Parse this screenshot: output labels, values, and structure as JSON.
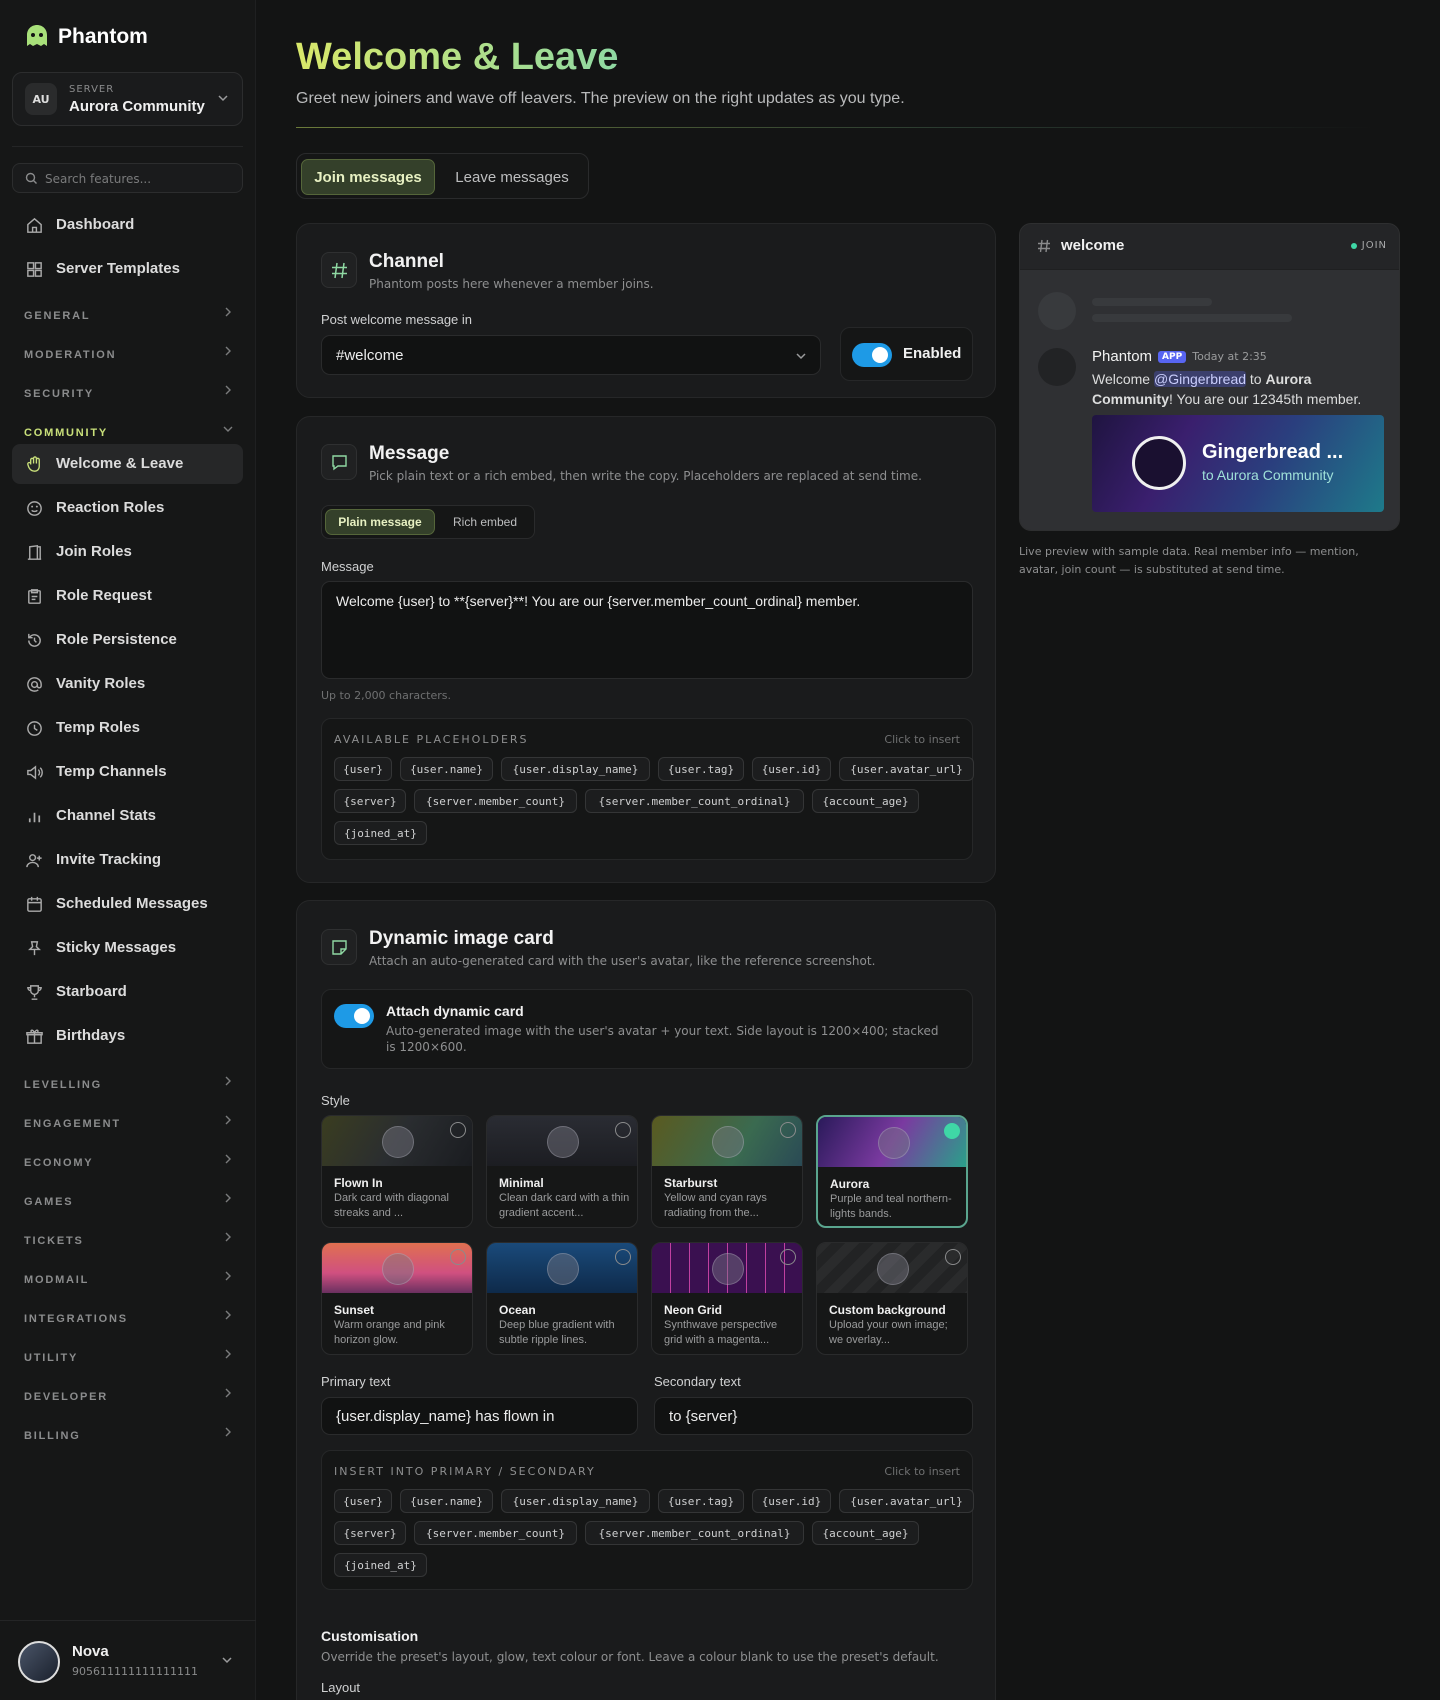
{
  "app": {
    "name": "Phantom"
  },
  "server": {
    "label": "SERVER",
    "initials": "AU",
    "name": "Aurora Community"
  },
  "search": {
    "placeholder": "Search features..."
  },
  "nav_top": [
    {
      "label": "Dashboard",
      "icon": "home-icon"
    },
    {
      "label": "Server Templates",
      "icon": "grid-icon"
    }
  ],
  "sections_collapsed_top": [
    "GENERAL",
    "MODERATION",
    "SECURITY"
  ],
  "section_community": "COMMUNITY",
  "nav_community": [
    {
      "label": "Welcome & Leave",
      "icon": "wave-hand-icon",
      "active": true
    },
    {
      "label": "Reaction Roles",
      "icon": "smile-icon"
    },
    {
      "label": "Join Roles",
      "icon": "door-icon"
    },
    {
      "label": "Role Request",
      "icon": "clipboard-icon"
    },
    {
      "label": "Role Persistence",
      "icon": "history-icon"
    },
    {
      "label": "Vanity Roles",
      "icon": "at-icon"
    },
    {
      "label": "Temp Roles",
      "icon": "clock-icon"
    },
    {
      "label": "Temp Channels",
      "icon": "speaker-icon"
    },
    {
      "label": "Channel Stats",
      "icon": "bar-chart-icon"
    },
    {
      "label": "Invite Tracking",
      "icon": "user-plus-icon"
    },
    {
      "label": "Scheduled Messages",
      "icon": "calendar-icon"
    },
    {
      "label": "Sticky Messages",
      "icon": "pin-icon"
    },
    {
      "label": "Starboard",
      "icon": "trophy-icon"
    },
    {
      "label": "Birthdays",
      "icon": "gift-icon"
    }
  ],
  "sections_collapsed_bottom": [
    "LEVELLING",
    "ENGAGEMENT",
    "ECONOMY",
    "GAMES",
    "TICKETS",
    "MODMAIL",
    "INTEGRATIONS",
    "UTILITY",
    "DEVELOPER",
    "BILLING"
  ],
  "user": {
    "name": "Nova",
    "id": "905611111111111111"
  },
  "page": {
    "title": "Welcome & Leave",
    "subtitle": "Greet new joiners and wave off leavers. The preview on the right updates as you type."
  },
  "tabs": [
    "Join messages",
    "Leave messages"
  ],
  "channel_card": {
    "title": "Channel",
    "desc": "Phantom posts here whenever a member joins.",
    "label": "Post welcome message in",
    "value": "#welcome",
    "toggle_label": "Enabled"
  },
  "message_card": {
    "title": "Message",
    "desc": "Pick plain text or a rich embed, then write the copy. Placeholders are replaced at send time.",
    "modes": [
      "Plain message",
      "Rich embed"
    ],
    "label": "Message",
    "value": "Welcome {user} to **{server}**! You are our {server.member_count_ordinal} member.",
    "hint": "Up to 2,000 characters.",
    "ph_title": "AVAILABLE PLACEHOLDERS",
    "ph_hint": "Click to insert"
  },
  "placeholders": [
    "{user}",
    "{user.name}",
    "{user.display_name}",
    "{user.tag}",
    "{user.id}",
    "{user.avatar_url}",
    "{server}",
    "{server.member_count}",
    "{server.member_count_ordinal}",
    "{account_age}",
    "{joined_at}"
  ],
  "image_card": {
    "title": "Dynamic image card",
    "desc": "Attach an auto-generated card with the user's avatar, like the reference screenshot.",
    "attach_title": "Attach dynamic card",
    "attach_desc": "Auto-generated image with the user's avatar + your text. Side layout is 1200×400; stacked is 1200×600.",
    "style_label": "Style",
    "styles": [
      {
        "name": "Flown In",
        "desc": "Dark card with diagonal streaks and ..."
      },
      {
        "name": "Minimal",
        "desc": "Clean dark card with a thin gradient accent..."
      },
      {
        "name": "Starburst",
        "desc": "Yellow and cyan rays radiating from the..."
      },
      {
        "name": "Aurora",
        "desc": "Purple and teal northern-lights bands."
      },
      {
        "name": "Sunset",
        "desc": "Warm orange and pink horizon glow."
      },
      {
        "name": "Ocean",
        "desc": "Deep blue gradient with subtle ripple lines."
      },
      {
        "name": "Neon Grid",
        "desc": "Synthwave perspective grid with a magenta..."
      },
      {
        "name": "Custom background",
        "desc": "Upload your own image; we overlay..."
      }
    ],
    "primary_label": "Primary text",
    "primary_value": "{user.display_name} has flown in",
    "secondary_label": "Secondary text",
    "secondary_value": "to {server}",
    "insert_title": "INSERT INTO PRIMARY / SECONDARY",
    "insert_hint": "Click to insert",
    "custom_title": "Customisation",
    "custom_desc": "Override the preset's layout, glow, text colour or font. Leave a colour blank to use the preset's default.",
    "layout_label": "Layout"
  },
  "preview": {
    "channel": "welcome",
    "badge": "JOIN",
    "bot_name": "Phantom",
    "app_tag": "APP",
    "time": "Today at 2:35",
    "msg_1": "Welcome ",
    "mention": "@Gingerbread",
    "msg_2": " to ",
    "server_bold": "Aurora Community",
    "msg_3": "! You are our 12345th member.",
    "card_name": "Gingerbread ...",
    "card_sub": "to Aurora Community",
    "note": "Live preview with sample data. Real member info — mention, avatar, join count — is substituted at send time."
  },
  "colors": {
    "accent": "#c9e07a",
    "toggle": "#1e9ae6",
    "selected": "#3fd7a6",
    "mention": "#5865f2"
  }
}
